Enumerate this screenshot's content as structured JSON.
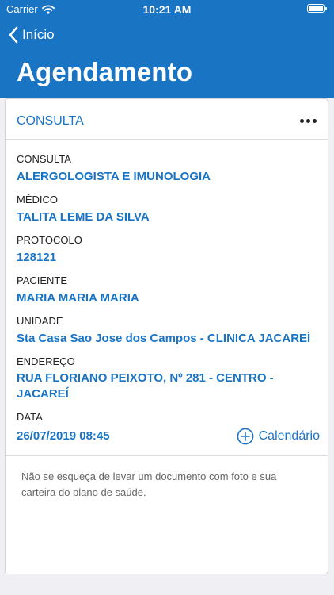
{
  "status_bar": {
    "carrier": "Carrier",
    "time": "10:21 AM"
  },
  "nav": {
    "back_label": "Início",
    "title": "Agendamento"
  },
  "card": {
    "title": "CONSULTA",
    "fields": [
      {
        "label": "CONSULTA",
        "value": "ALERGOLOGISTA E IMUNOLOGIA"
      },
      {
        "label": "MÉDICO",
        "value": "TALITA LEME DA SILVA"
      },
      {
        "label": "PROTOCOLO",
        "value": "128121"
      },
      {
        "label": "PACIENTE",
        "value": "MARIA MARIA MARIA"
      },
      {
        "label": "UNIDADE",
        "value": "Sta Casa Sao Jose dos Campos - CLINICA JACAREÍ"
      },
      {
        "label": "ENDEREÇO",
        "value": "RUA FLORIANO PEIXOTO, Nº 281 - CENTRO - JACAREÍ"
      },
      {
        "label": "DATA",
        "value": "26/07/2019 08:45"
      }
    ],
    "calendar_label": "Calendário",
    "note": "Não se esqueça de levar um documento com foto e sua carteira do plano de saúde."
  },
  "colors": {
    "accent": "#1a74c4",
    "background": "#efeff4"
  },
  "icons": {
    "back": "chevron-left-icon",
    "more": "more-horizontal-icon",
    "calendar": "plus-circle-icon",
    "wifi": "wifi-icon",
    "battery": "battery-icon"
  }
}
